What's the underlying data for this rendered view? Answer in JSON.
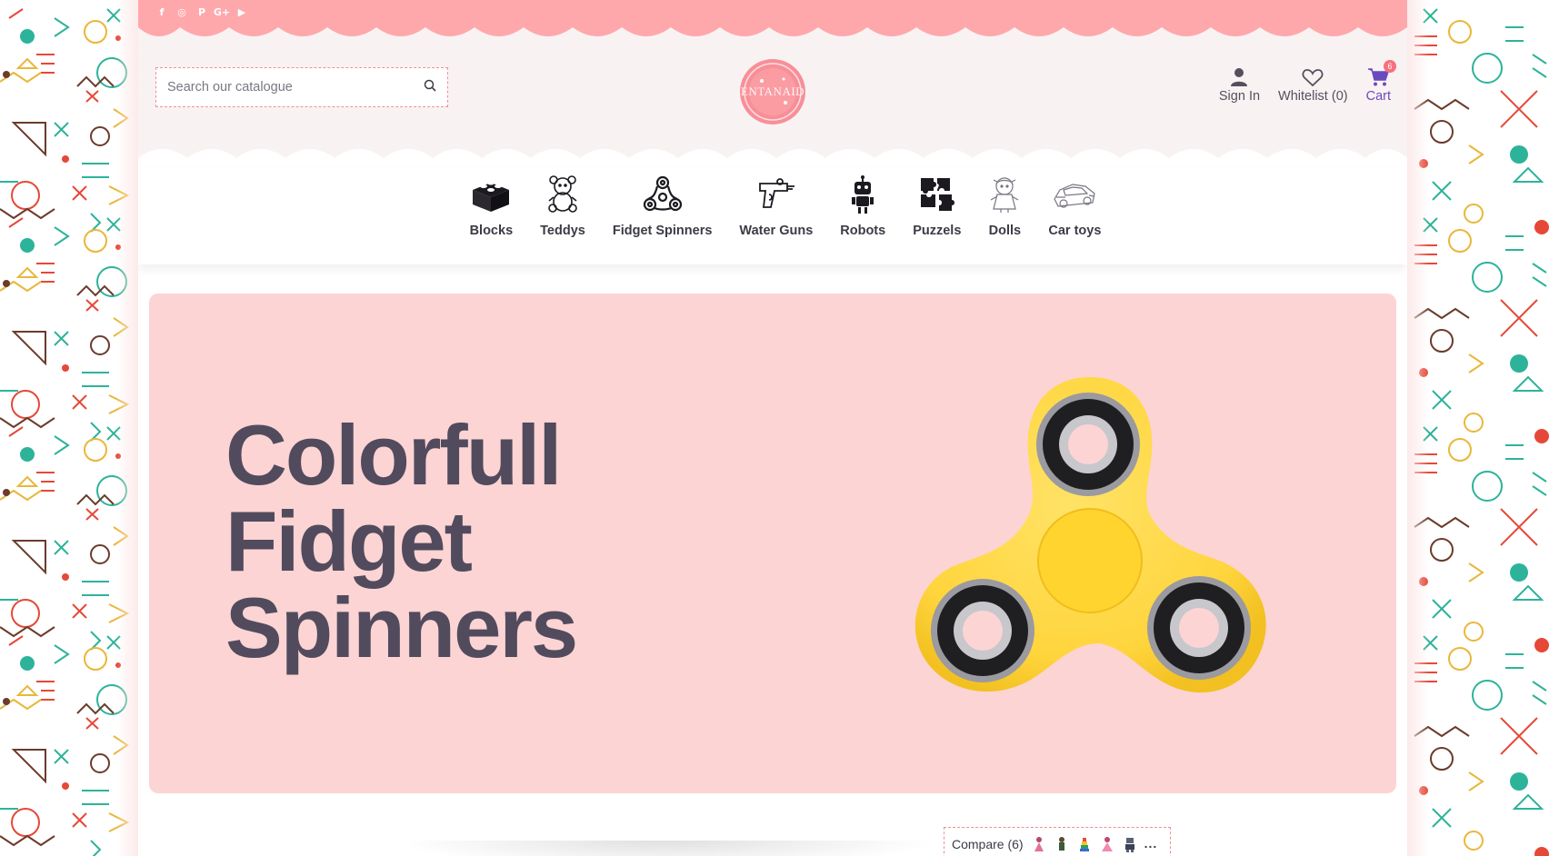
{
  "social": {
    "icons": [
      "facebook-icon",
      "instagram-icon",
      "pinterest-icon",
      "google-plus-icon",
      "youtube-icon"
    ],
    "glyphs": [
      "f",
      "◎",
      "P",
      "G+",
      "▶"
    ]
  },
  "search": {
    "placeholder": "Search our catalogue"
  },
  "logo": {
    "text": "ENTANAID"
  },
  "account": {
    "sign_in": "Sign In",
    "wishlist": "Whitelist (0)",
    "cart": "Cart",
    "cart_count": "6"
  },
  "categories": [
    {
      "label": "Blocks",
      "icon": "blocks-icon"
    },
    {
      "label": "Teddys",
      "icon": "teddy-bear-icon"
    },
    {
      "label": "Fidget Spinners",
      "icon": "fidget-spinner-icon"
    },
    {
      "label": "Water Guns",
      "icon": "water-gun-icon"
    },
    {
      "label": "Robots",
      "icon": "robot-icon"
    },
    {
      "label": "Puzzels",
      "icon": "puzzle-icon"
    },
    {
      "label": "Dolls",
      "icon": "doll-icon"
    },
    {
      "label": "Car toys",
      "icon": "car-icon"
    }
  ],
  "hero": {
    "line1": "Colorfull",
    "line2": "Fidget",
    "line3": "Spinners",
    "background": "#fcd4d4",
    "title_color": "#514b5d",
    "spinner_color": "#ffd53d"
  },
  "compare": {
    "label": "Compare (6)",
    "more": "..."
  },
  "colors": {
    "topbar": "#ffa8ab",
    "header_bg": "#f9f2f3",
    "accent_dash": "#f08f95",
    "cart_accent": "#6a4bbd"
  }
}
